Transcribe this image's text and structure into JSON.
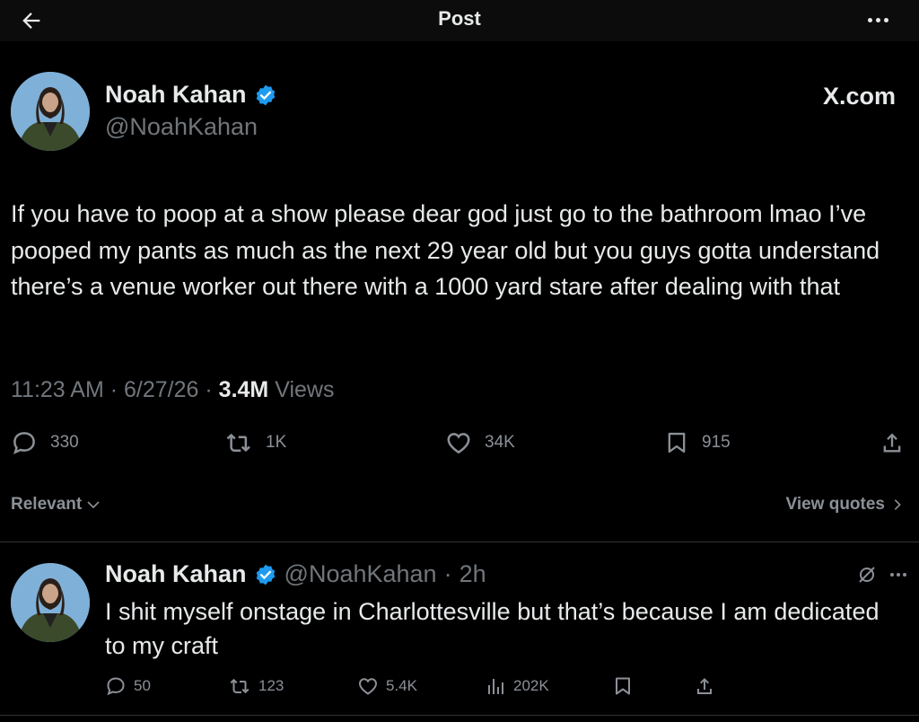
{
  "header": {
    "title": "Post",
    "back_icon": "arrow-left-icon",
    "more_icon": "more-horizontal-icon"
  },
  "post": {
    "author_name": "Noah Kahan",
    "author_handle": "@NoahKahan",
    "verified_icon": "verified-badge-icon",
    "watermark": "X.com",
    "text": "If you have to poop at a show please dear god just go to the bathroom lmao I’ve pooped my pants as much as the next 29 year old but you guys gotta understand there’s a venue worker out there with a 1000 yard stare after dealing with that",
    "time": "11:23 AM",
    "date": "6/27/26",
    "views_count": "3.4M",
    "views_label": "Views",
    "separator": "·",
    "stats": {
      "replies": "330",
      "reposts": "1K",
      "likes": "34K",
      "bookmarks": "915"
    }
  },
  "sort": {
    "label": "Relevant",
    "view_quotes": "View quotes"
  },
  "reply": {
    "author_name": "Noah Kahan",
    "author_handle": "@NoahKahan",
    "time_sep": "·",
    "time": "2h",
    "text": "I shit myself onstage in Charlottesville but that’s because I am dedicated to my craft",
    "stats": {
      "replies": "50",
      "reposts": "123",
      "likes": "5.4K",
      "views": "202K"
    }
  },
  "colors": {
    "background": "#000000",
    "text": "#e7e9ea",
    "muted": "#71767b",
    "verified": "#1d9bf0",
    "divider": "#2f3336"
  }
}
